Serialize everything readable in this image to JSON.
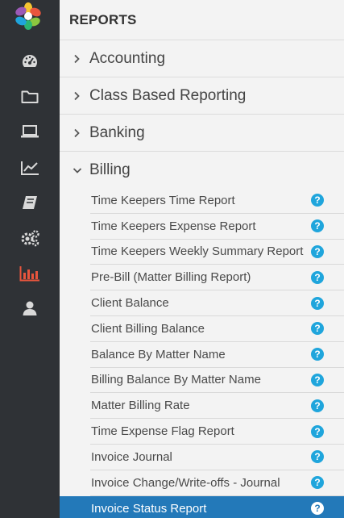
{
  "colors": {
    "rail_bg": "#2f3236",
    "rail_icon": "#d9d9d9",
    "rail_active_icon": "#e8553d",
    "panel_bg": "#f3f3f3",
    "help_icon": "#1fa5dc",
    "active_row_bg": "#2379b9"
  },
  "rail": {
    "items": [
      {
        "icon": "dashboard-icon",
        "active": false
      },
      {
        "icon": "folder-icon",
        "active": false
      },
      {
        "icon": "laptop-icon",
        "active": false
      },
      {
        "icon": "line-chart-icon",
        "active": false
      },
      {
        "icon": "book-icon",
        "active": false
      },
      {
        "icon": "gears-icon",
        "active": false
      },
      {
        "icon": "bar-chart-icon",
        "active": true
      },
      {
        "icon": "user-icon",
        "active": false
      }
    ]
  },
  "panel": {
    "title": "REPORTS",
    "sections": [
      {
        "label": "Accounting",
        "expanded": false
      },
      {
        "label": "Class Based Reporting",
        "expanded": false
      },
      {
        "label": "Banking",
        "expanded": false
      },
      {
        "label": "Billing",
        "expanded": true
      }
    ],
    "billing_reports": [
      {
        "label": "Time Keepers Time Report",
        "help": "?"
      },
      {
        "label": "Time Keepers Expense Report",
        "help": "?"
      },
      {
        "label": "Time Keepers Weekly Summary Report",
        "help": "?"
      },
      {
        "label": "Pre-Bill (Matter Billing Report)",
        "help": "?"
      },
      {
        "label": "Client Balance",
        "help": "?"
      },
      {
        "label": "Client Billing Balance",
        "help": "?"
      },
      {
        "label": "Balance By Matter Name",
        "help": "?"
      },
      {
        "label": "Billing Balance By Matter Name",
        "help": "?"
      },
      {
        "label": "Matter Billing Rate",
        "help": "?"
      },
      {
        "label": "Time Expense Flag Report",
        "help": "?"
      },
      {
        "label": "Invoice Journal",
        "help": "?"
      },
      {
        "label": "Invoice Change/Write-offs - Journal",
        "help": "?"
      },
      {
        "label": "Invoice Status Report",
        "help": "?",
        "active": true
      }
    ]
  }
}
